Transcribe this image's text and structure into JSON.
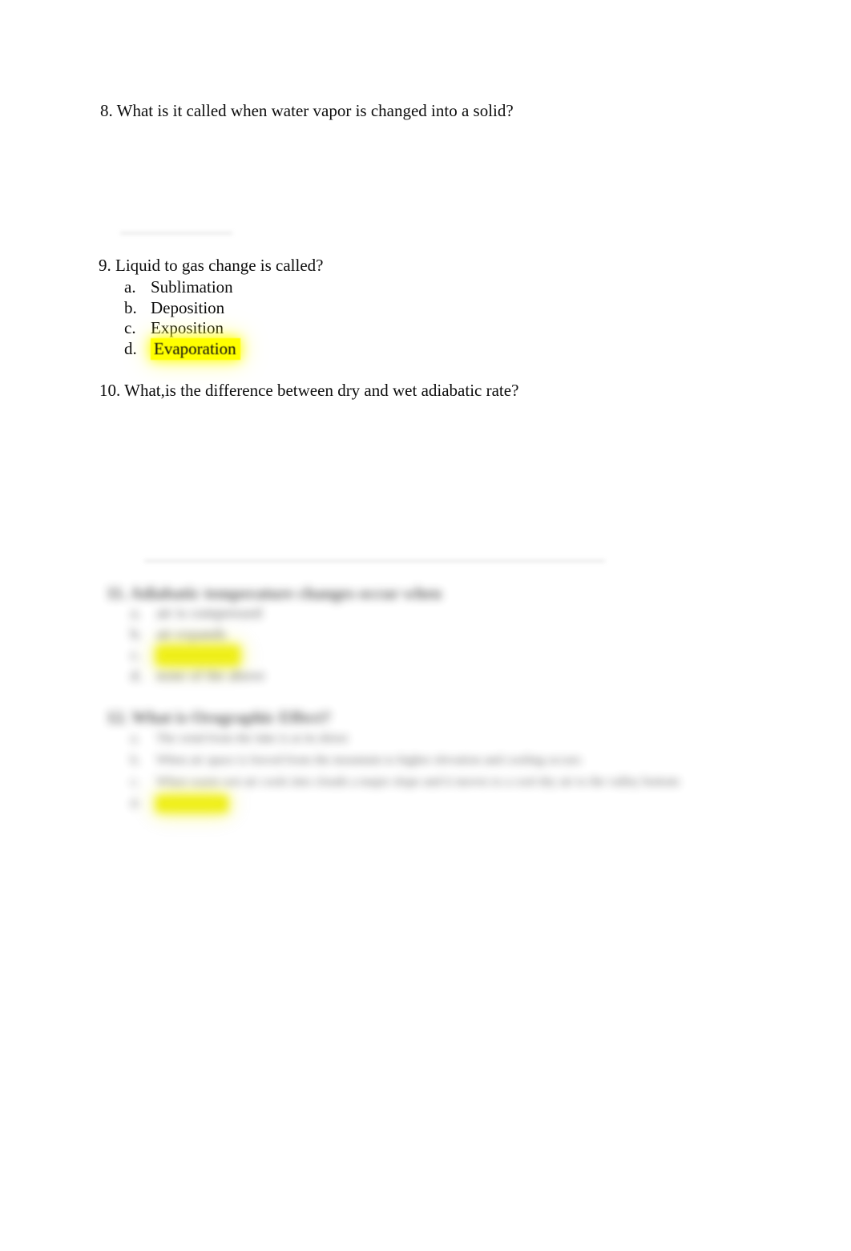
{
  "document": {
    "type": "quiz-worksheet",
    "page_background": "#ffffff",
    "text_color": "#000000",
    "highlight_color": "#ffff00"
  },
  "questions": [
    {
      "number": "8.",
      "text": "8. What is it called when water vapor is changed into a solid?",
      "answer_line": true,
      "blurred": false
    },
    {
      "number": "9.",
      "text": "9. Liquid to gas change is called?",
      "blurred": false,
      "options": [
        {
          "marker": "a.",
          "text": "Sublimation",
          "highlighted": false
        },
        {
          "marker": "b.",
          "text": "Deposition",
          "highlighted": false
        },
        {
          "marker": "c.",
          "text": "Exposition",
          "highlighted": false
        },
        {
          "marker": "d.",
          "text": "Evaporation",
          "highlighted": true
        }
      ]
    },
    {
      "number": "10.",
      "text": "10. What,is the difference between dry and wet adiabatic rate?",
      "answer_line": true,
      "blurred": false
    },
    {
      "number": "11.",
      "text": "11. Adiabatic temperature changes occur when",
      "blurred": true,
      "options": [
        {
          "marker": "a.",
          "text": "air is compressed",
          "highlighted": false
        },
        {
          "marker": "b.",
          "text": "air expands",
          "highlighted": false
        },
        {
          "marker": "c.",
          "text": "both a and b",
          "highlighted": true
        },
        {
          "marker": "d.",
          "text": "none of the above",
          "highlighted": false
        }
      ]
    },
    {
      "number": "12.",
      "text": "12. What is Orographic Effect?",
      "blurred": true,
      "options": [
        {
          "marker": "a.",
          "text": "The wind from the lake is at its driest",
          "highlighted": false
        },
        {
          "marker": "b.",
          "text": "When air space is forced from the mountain to higher elevation and cooling occurs",
          "highlighted": false
        },
        {
          "marker": "c.",
          "text": "When warm wet air cools into clouds a major slope and it moves to a cool dry air to the valley bottom",
          "highlighted": false
        },
        {
          "marker": "d.",
          "text": "both a and c",
          "highlighted": true
        }
      ]
    }
  ]
}
